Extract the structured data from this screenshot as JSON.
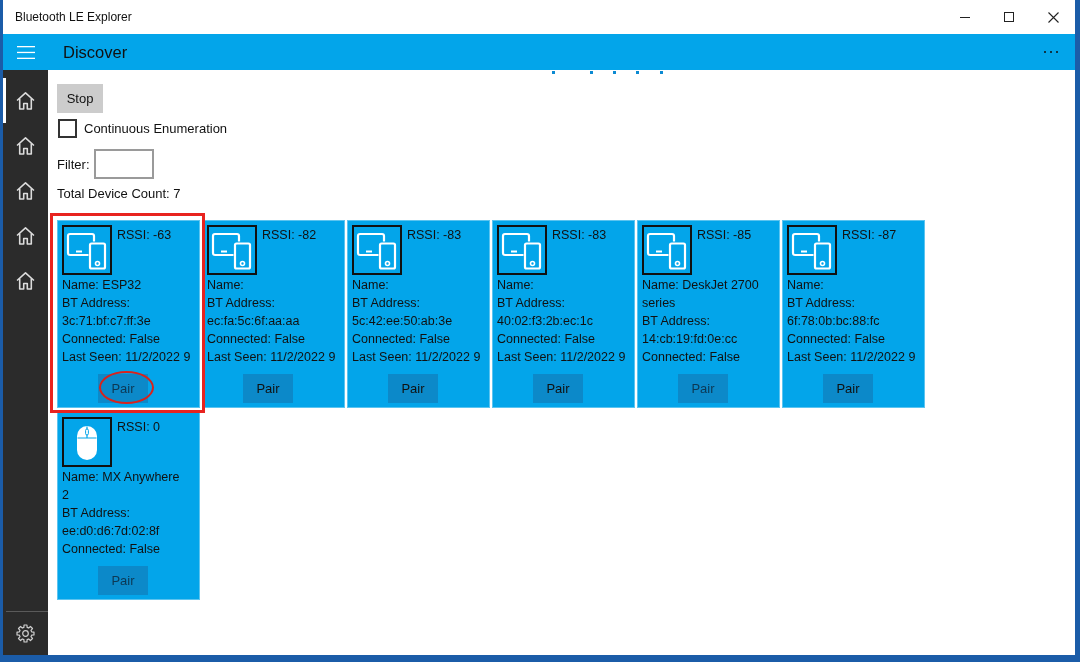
{
  "window": {
    "title": "Bluetooth LE Explorer"
  },
  "header": {
    "title": "Discover"
  },
  "sidebar": {
    "items": [
      {
        "selected": true
      },
      {
        "selected": false
      },
      {
        "selected": false
      },
      {
        "selected": false
      },
      {
        "selected": false
      }
    ]
  },
  "controls": {
    "stop_button": "Stop",
    "continuous_enumeration": {
      "label": "Continuous Enumeration",
      "checked": false
    },
    "filter": {
      "label": "Filter:"
    },
    "device_count": "Total Device Count: 7"
  },
  "devices": [
    {
      "kind": "computer",
      "rssi": "RSSI: -63",
      "name": "Name: ESP32",
      "address_label": "BT Address:",
      "address": "3c:71:bf:c7:ff:3e",
      "connected": "Connected: False",
      "last_seen": "Last Seen: 11/2/2022 9",
      "pair": {
        "label": "Pair",
        "disabled": true
      },
      "highlighted": true,
      "pair_circled": true
    },
    {
      "kind": "computer",
      "rssi": "RSSI: -82",
      "name": "Name:",
      "address_label": "BT Address:",
      "address": "ec:fa:5c:6f:aa:aa",
      "connected": "Connected: False",
      "last_seen": "Last Seen: 11/2/2022 9",
      "pair": {
        "label": "Pair",
        "disabled": false
      },
      "highlighted": false,
      "pair_circled": false
    },
    {
      "kind": "computer",
      "rssi": "RSSI: -83",
      "name": "Name:",
      "address_label": "BT Address:",
      "address": "5c:42:ee:50:ab:3e",
      "connected": "Connected: False",
      "last_seen": "Last Seen: 11/2/2022 9",
      "pair": {
        "label": "Pair",
        "disabled": false
      },
      "highlighted": false,
      "pair_circled": false
    },
    {
      "kind": "computer",
      "rssi": "RSSI: -83",
      "name": "Name:",
      "address_label": "BT Address:",
      "address": "40:02:f3:2b:ec:1c",
      "connected": "Connected: False",
      "last_seen": "Last Seen: 11/2/2022 9",
      "pair": {
        "label": "Pair",
        "disabled": false
      },
      "highlighted": false,
      "pair_circled": false
    },
    {
      "kind": "computer",
      "rssi": "RSSI: -85",
      "name": "Name: DeskJet 2700 series",
      "address_label": "BT Address:",
      "address": "14:cb:19:fd:0e:cc",
      "connected": "Connected: False",
      "pair": {
        "label": "Pair",
        "disabled": true
      },
      "highlighted": false,
      "pair_circled": false
    },
    {
      "kind": "computer",
      "rssi": "RSSI: -87",
      "name": "Name:",
      "address_label": "BT Address:",
      "address": "6f:78:0b:bc:88:fc",
      "connected": "Connected: False",
      "last_seen": "Last Seen: 11/2/2022 9",
      "pair": {
        "label": "Pair",
        "disabled": false
      },
      "highlighted": false,
      "pair_circled": false
    },
    {
      "kind": "mouse",
      "rssi": "RSSI: 0",
      "name": "Name: MX Anywhere 2",
      "address_label": "BT Address:",
      "address": "ee:d0:d6:7d:02:8f",
      "connected": "Connected: False",
      "pair": {
        "label": "Pair",
        "disabled": true
      },
      "highlighted": false,
      "pair_circled": false
    }
  ]
}
